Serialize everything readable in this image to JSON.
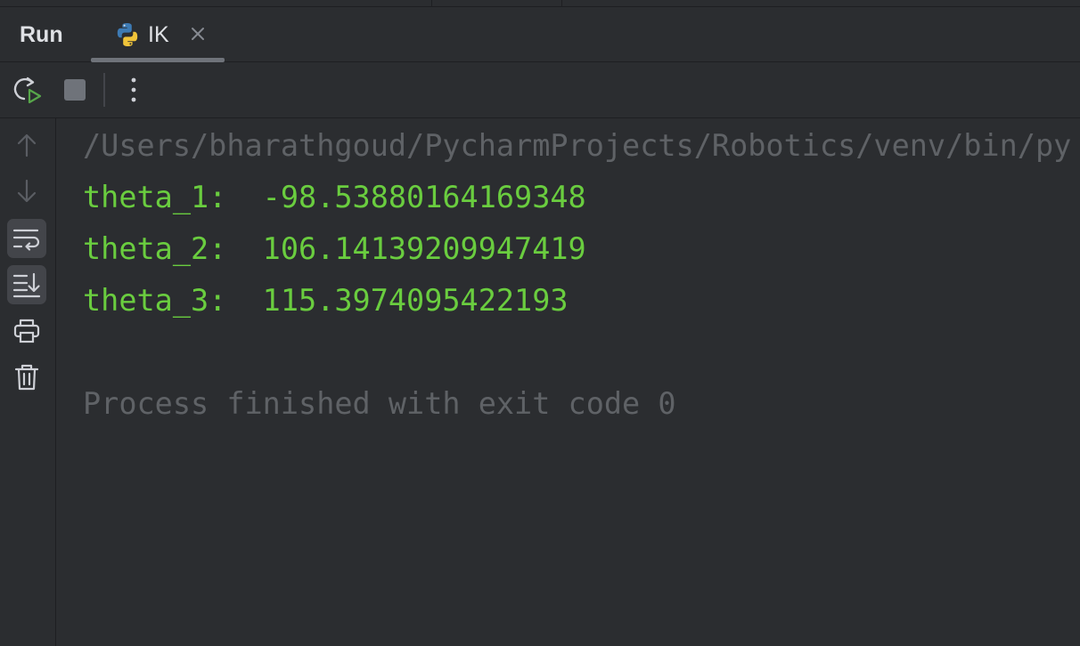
{
  "panel": {
    "title": "Run",
    "tab": {
      "label": "IK",
      "icon": "python-icon"
    }
  },
  "toolbar": {
    "rerun": "rerun-icon",
    "stop": "stop-icon",
    "more": "more-options-icon"
  },
  "sidebar": {
    "items": [
      {
        "icon": "arrow-up-icon",
        "name": "scroll-up"
      },
      {
        "icon": "arrow-down-icon",
        "name": "scroll-down"
      },
      {
        "icon": "soft-wrap-icon",
        "name": "soft-wrap"
      },
      {
        "icon": "scroll-to-end-icon",
        "name": "scroll-to-end"
      },
      {
        "icon": "print-icon",
        "name": "print"
      },
      {
        "icon": "trash-icon",
        "name": "clear-all"
      }
    ]
  },
  "console": {
    "command": "/Users/bharathgoud/PycharmProjects/Robotics/venv/bin/py",
    "output": [
      "theta_1:  -98.53880164169348",
      "theta_2:  106.14139209947419",
      "theta_3:  115.3974095422193"
    ],
    "exit_message": "Process finished with exit code 0"
  },
  "colors": {
    "background": "#2b2d30",
    "output_text": "#6acd3f",
    "dim_text": "#5f6266",
    "primary_text": "#dfe1e5"
  }
}
